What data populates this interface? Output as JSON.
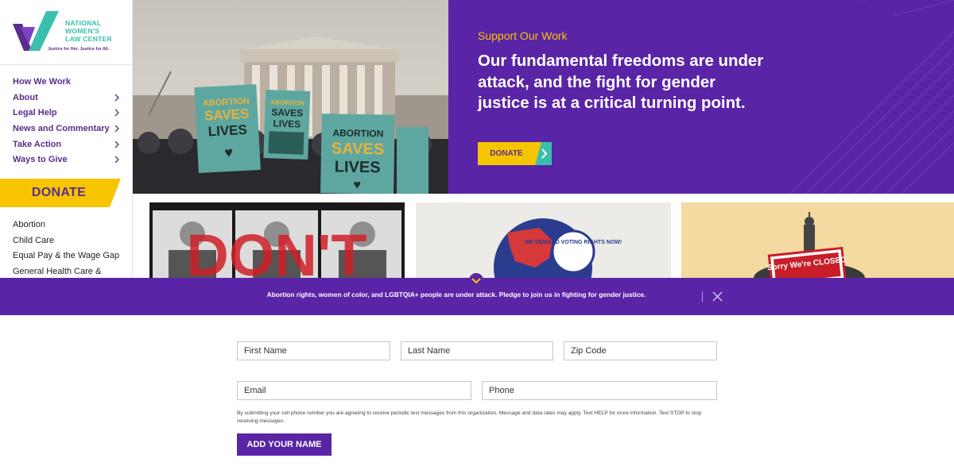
{
  "logo": {
    "name_lines": [
      "NATIONAL",
      "WOMEN'S",
      "LAW CENTER"
    ],
    "tagline": "Justice for Her. Justice for All."
  },
  "nav": {
    "items": [
      {
        "label": "How We Work",
        "has_submenu": false
      },
      {
        "label": "About",
        "has_submenu": true
      },
      {
        "label": "Legal Help",
        "has_submenu": true
      },
      {
        "label": "News and Commentary",
        "has_submenu": true
      },
      {
        "label": "Take Action",
        "has_submenu": true
      },
      {
        "label": "Ways to Give",
        "has_submenu": true
      }
    ],
    "donate_label": "DONATE"
  },
  "topics": [
    "Abortion",
    "Child Care",
    "Equal Pay & the Wage Gap",
    "General Health Care &"
  ],
  "hero": {
    "eyebrow": "Support Our Work",
    "headline": "Our fundamental freedoms are under attack, and the fight for gender justice is at a critical turning point.",
    "button_label": "DONATE",
    "sign_texts": [
      "ABORTION SAVES LIVES",
      "ABORTION SAVES LIVES",
      "ABORTION SAVES LIVES"
    ]
  },
  "cards": [
    {
      "graphic_text": "DON'T"
    },
    {
      "graphic_text": "WE DEMAND VOTING RIGHTS NOW!"
    },
    {
      "graphic_text": "Sorry We're CLOSED"
    }
  ],
  "pledge": {
    "message": "Abortion rights, women of color, and LGBTQIA+ people are under attack. Pledge to join us in fighting for gender justice.",
    "fields": {
      "first_name": "First Name",
      "last_name": "Last Name",
      "zip": "Zip Code",
      "email": "Email",
      "phone": "Phone"
    },
    "disclaimer": "By submitting your cell phone number you are agreeing to receive periodic text messages from this organization. Message and data rates may apply. Text HELP for more information. Text STOP to stop receiving messages.",
    "submit_label": "ADD YOUR NAME"
  },
  "colors": {
    "purple": "#5a24a6",
    "yellow": "#f6c500",
    "teal": "#3bbfad"
  }
}
